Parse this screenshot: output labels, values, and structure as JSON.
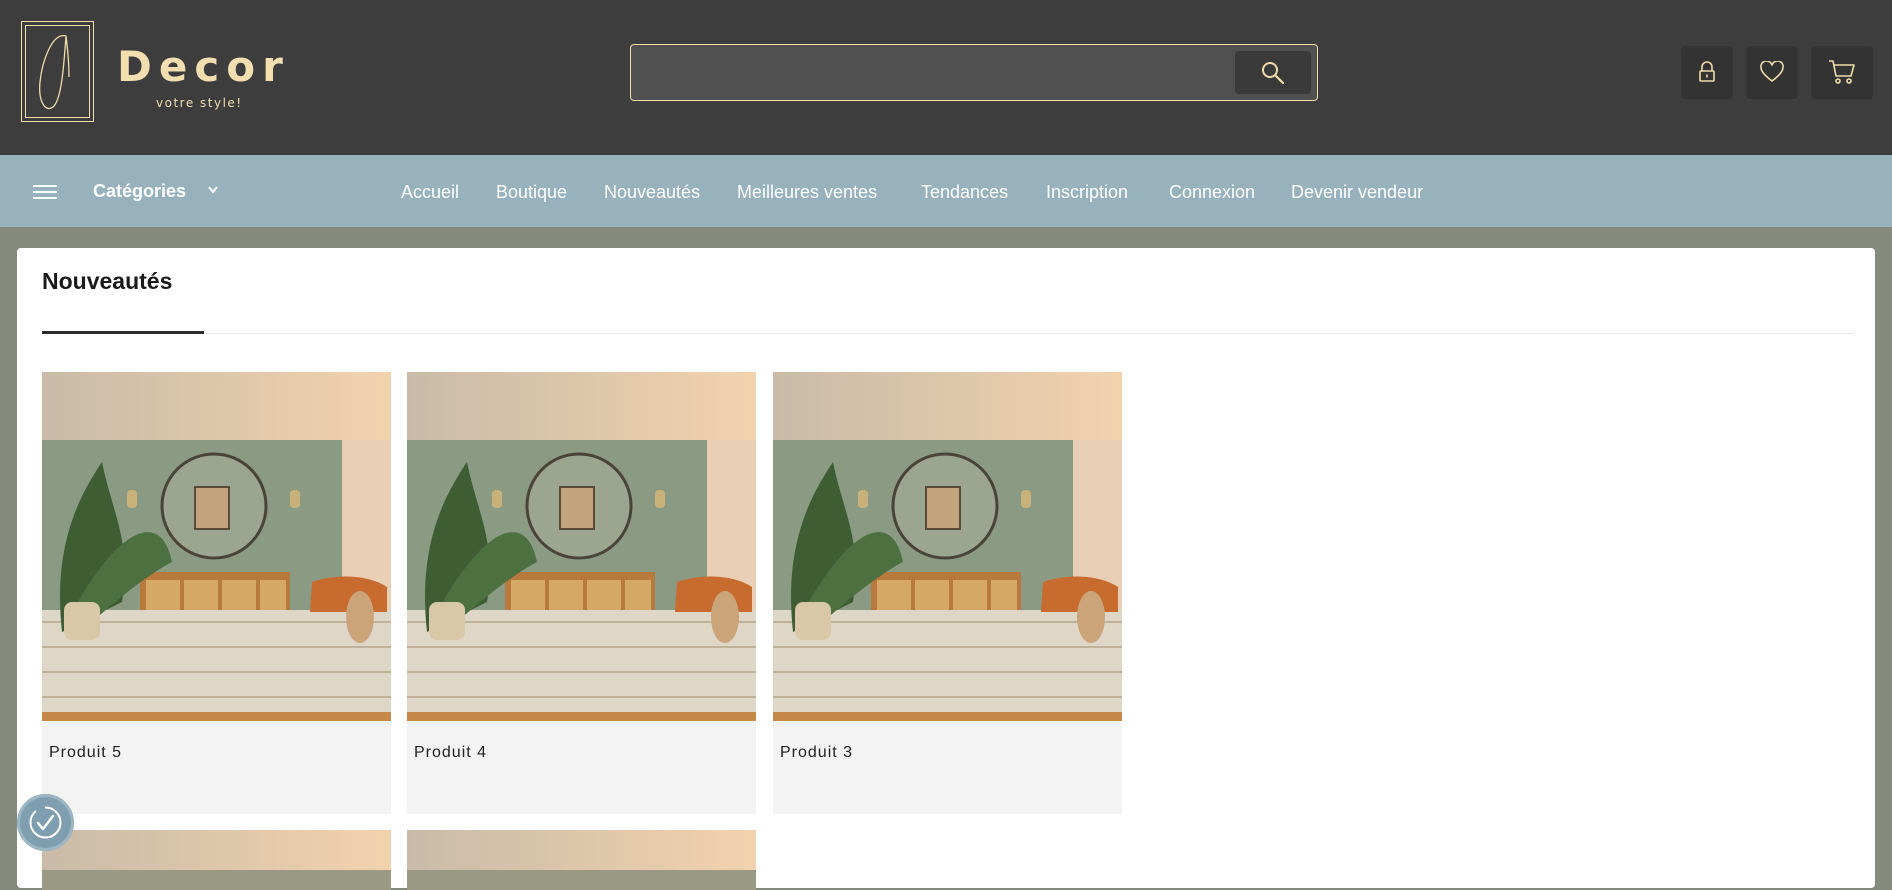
{
  "brand": {
    "name": "Decor",
    "tagline": "votre style!"
  },
  "search": {
    "placeholder": ""
  },
  "header_icons": [
    "lock-icon",
    "heart-icon",
    "cart-icon"
  ],
  "nav": {
    "categories_label": "Catégories",
    "links": [
      "Accueil",
      "Boutique",
      "Nouveautés",
      "Meilleures ventes",
      "Tendances",
      "Inscription",
      "Connexion",
      "Devenir vendeur"
    ]
  },
  "section": {
    "title": "Nouveautés",
    "products": [
      {
        "name": "Produit 5"
      },
      {
        "name": "Produit 4"
      },
      {
        "name": "Produit 3"
      },
      {
        "name": ""
      },
      {
        "name": ""
      }
    ]
  },
  "colors": {
    "header_bg": "#3d3d3d",
    "accent_gold": "#f3deb0",
    "nav_bg": "#98b2bd",
    "page_bg": "#848b7c"
  }
}
